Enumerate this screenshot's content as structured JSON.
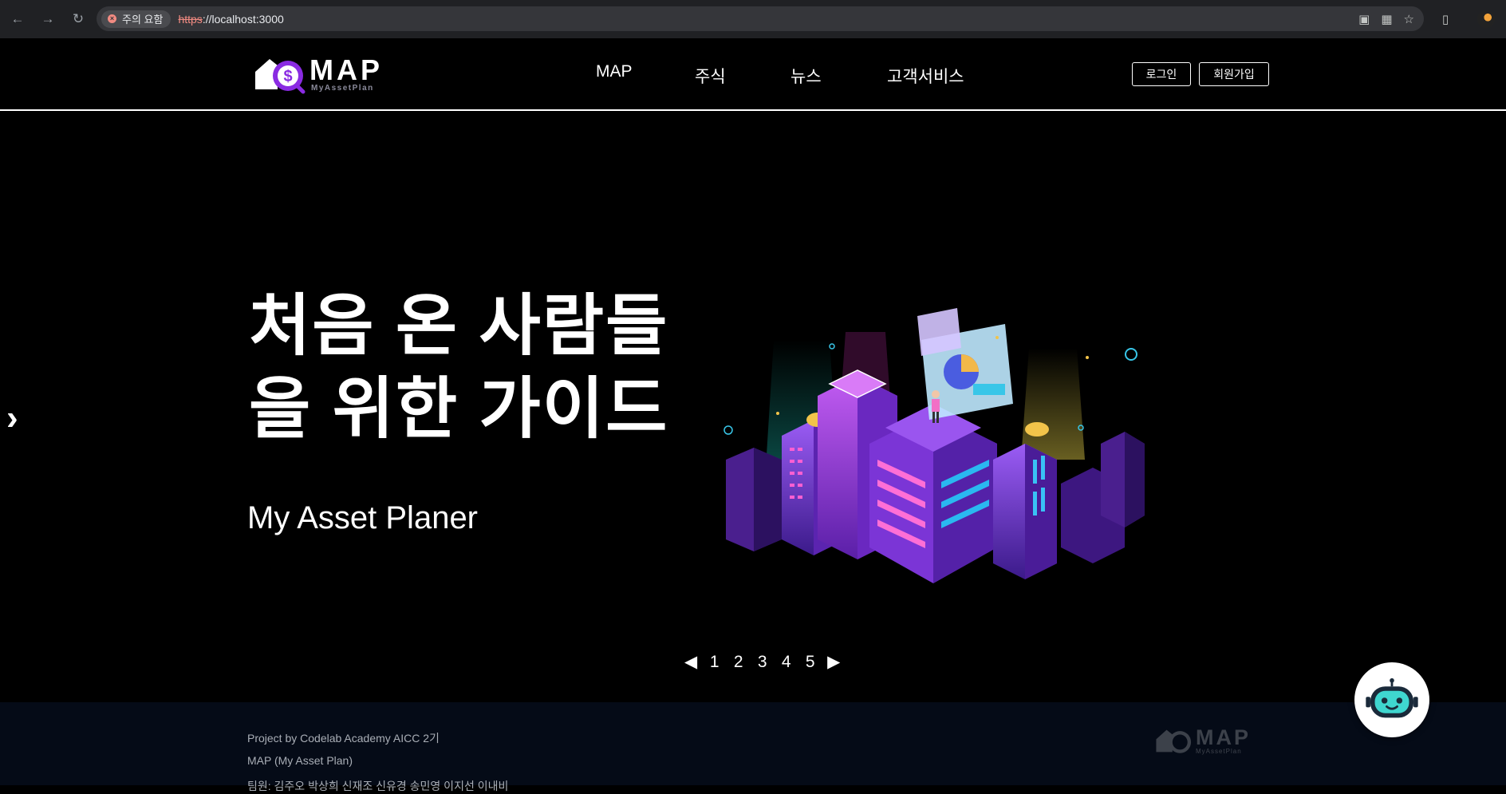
{
  "browser": {
    "security_label": "주의 요함",
    "url_scheme": "https",
    "url_rest": "://localhost:3000"
  },
  "header": {
    "logo_word": "MAP",
    "logo_sub": "MyAssetPlan",
    "nav": [
      {
        "label": "MAP"
      },
      {
        "label": "주식"
      },
      {
        "label": "뉴스"
      },
      {
        "label": "고객서비스"
      }
    ],
    "login_label": "로그인",
    "signup_label": "회원가입"
  },
  "hero": {
    "title_line1": "처음 온 사람들",
    "title_line2": "을 위한 가이드",
    "subtitle": "My Asset Planer",
    "pager": {
      "prev": "◀",
      "pages": [
        "1",
        "2",
        "3",
        "4",
        "5"
      ],
      "next": "▶"
    }
  },
  "footer": {
    "line1": "Project by Codelab Academy AICC 2기",
    "line2": "MAP (My Asset Plan)",
    "line3": "팀원: 김주오 박상희 신재조 신유경 송민영 이지선 이내비",
    "logo_word": "MAP",
    "logo_sub": "MyAssetPlan"
  },
  "colors": {
    "accent_purple": "#8a2be2",
    "background": "#000000",
    "footer_bg": "#050b17"
  }
}
